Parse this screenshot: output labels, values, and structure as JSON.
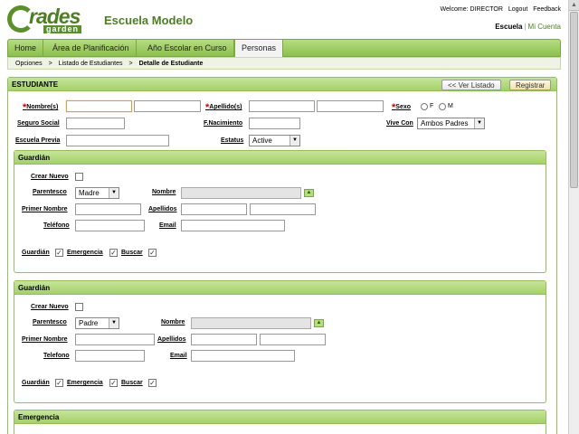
{
  "header": {
    "school": "Escuela Modelo",
    "welcome": "Welcome: DIRECTOR",
    "logout": "Logout",
    "feedback": "Feedback",
    "context": "Escuela",
    "my_account": "Mi Cuenta",
    "logo_rades": "rades",
    "logo_garden": "garden"
  },
  "nav": {
    "tabs": [
      "Home",
      "Área de Planificación",
      "Año Escolar en Curso",
      "Personas"
    ]
  },
  "breadcrumb": [
    "Opciones",
    ">",
    "Listado de Estudiantes",
    ">",
    "Detalle de Estudiante"
  ],
  "student": {
    "title": "ESTUDIANTE",
    "btn_list": "<< Ver Listado",
    "btn_register": "Registrar",
    "nombres": "Nombre(s)",
    "apellidos": "Apellido(s)",
    "sexo": "Sexo",
    "f": "F",
    "m": "M",
    "seguro": "Seguro Social",
    "nacimiento": "F.Nacimiento",
    "vive_con": "Vive Con",
    "vive_val": "Ambos Padres",
    "escuela_previa": "Escuela Previa",
    "estatus": "Estatus",
    "estatus_val": "Active"
  },
  "g1": {
    "title": "Guardián",
    "crear": "Crear Nuevo",
    "parentesco": "Parentesco",
    "parentesco_val": "Madre",
    "nombre": "Nombre",
    "primer": "Primer Nombre",
    "apellidos": "Apellidos",
    "telefono": "Teléfono",
    "email": "Email",
    "guardian": "Guardián",
    "emergencia": "Emergencia",
    "buscar": "Buscar"
  },
  "g2": {
    "title": "Guardián",
    "crear": "Crear Nuevo",
    "parentesco": "Parentesco",
    "parentesco_val": "Padre",
    "nombre": "Nombre",
    "primer": "Primer Nombre",
    "apellidos": "Apellidos",
    "telefono": "Telefono",
    "email": "Email",
    "guardian": "Guardián",
    "emergencia": "Emergencia",
    "buscar": "Buscar"
  },
  "emergencia": {
    "title": "Emergencia"
  },
  "colors": {
    "accent": "#4d7f22",
    "tab_bg": "#a6d06a"
  }
}
